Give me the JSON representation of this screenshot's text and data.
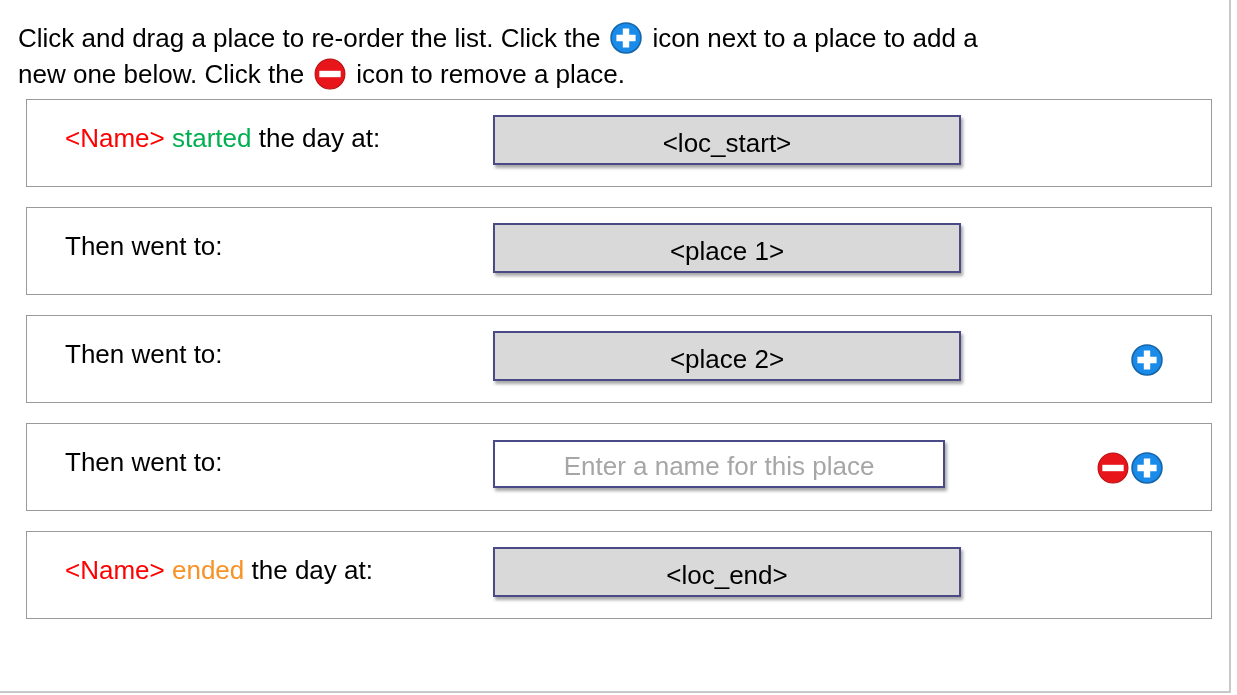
{
  "instructions": [
    [
      {
        "kind": "text",
        "text": "Click and drag a place to re-order the list. Click the"
      },
      {
        "kind": "add_icon"
      },
      {
        "kind": "text",
        "text": "icon next to a place to add a"
      }
    ],
    [
      {
        "kind": "text",
        "text": "new one below. Click the"
      },
      {
        "kind": "remove_icon"
      },
      {
        "kind": "text",
        "text": "icon to remove a place."
      }
    ]
  ],
  "rows": [
    {
      "label": [
        {
          "text": "<Name>",
          "color": "#ff0000"
        },
        {
          "text": "started",
          "color": "#00b050"
        },
        {
          "text": "the day at:",
          "color": "#000000"
        }
      ],
      "field": {
        "kind": "filled",
        "value": "<loc_start>"
      },
      "removable": false,
      "addable": false
    },
    {
      "label": [
        {
          "text": "Then went to:",
          "color": "#000000"
        }
      ],
      "field": {
        "kind": "filled",
        "value": "<place 1>"
      },
      "removable": false,
      "addable": false
    },
    {
      "label": [
        {
          "text": "Then went to:",
          "color": "#000000"
        }
      ],
      "field": {
        "kind": "filled",
        "value": "<place 2>"
      },
      "removable": false,
      "addable": true
    },
    {
      "label": [
        {
          "text": "Then went to:",
          "color": "#000000"
        }
      ],
      "field": {
        "kind": "empty",
        "placeholder": "Enter a name for this place"
      },
      "removable": true,
      "addable": true
    },
    {
      "label": [
        {
          "text": "<Name>",
          "color": "#ff0000"
        },
        {
          "text": "ended",
          "color": "#f79226"
        },
        {
          "text": "the day at:",
          "color": "#000000"
        }
      ],
      "field": {
        "kind": "filled",
        "value": "<loc_end>"
      },
      "removable": false,
      "addable": false
    }
  ]
}
